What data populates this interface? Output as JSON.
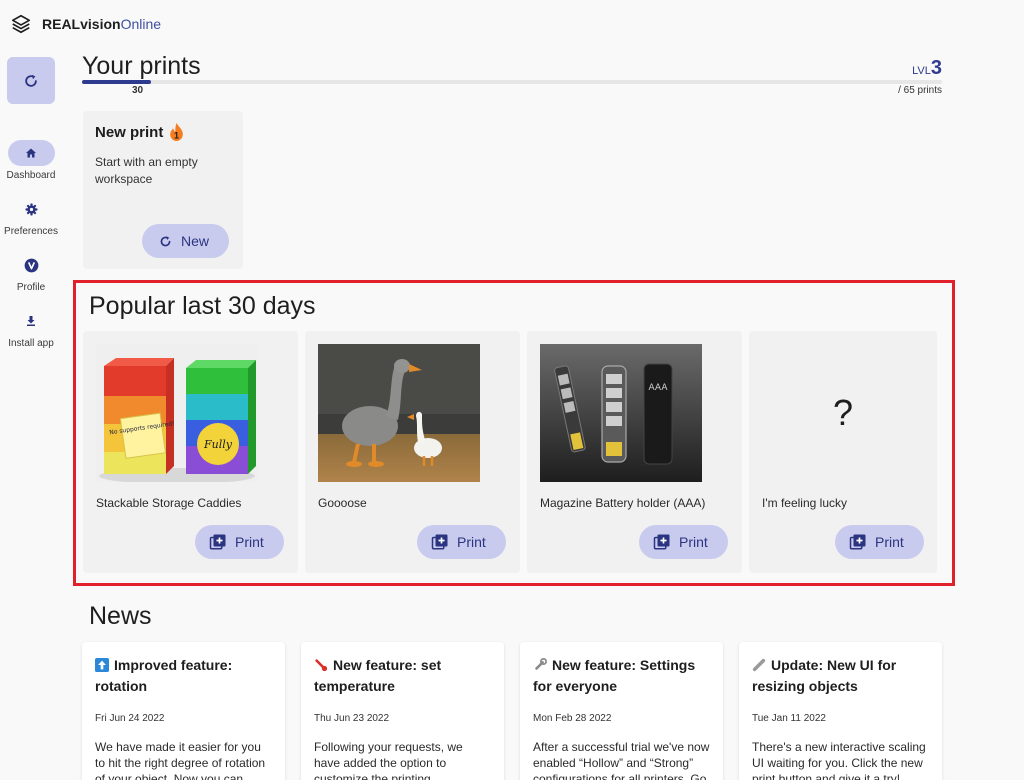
{
  "brand": {
    "bold": "REALvision",
    "accent": "Online",
    "logo_icon": "stacked-layers-icon"
  },
  "sidebar": {
    "refresh_icon": "refresh-icon",
    "items": [
      {
        "label": "Dashboard",
        "icon": "home-icon",
        "active": true
      },
      {
        "label": "Preferences",
        "icon": "gear-icon",
        "active": false
      },
      {
        "label": "Profile",
        "icon": "user-v-icon",
        "active": false
      },
      {
        "label": "Install app",
        "icon": "download-icon",
        "active": false
      }
    ]
  },
  "prints": {
    "title": "Your prints",
    "count": "30",
    "level_prefix": "LVL",
    "level": "3",
    "total": "/ 65 prints",
    "progress": 0.08
  },
  "new_print": {
    "title": "New print",
    "badge": "1",
    "description": "Start with an empty workspace",
    "button": "New"
  },
  "popular": {
    "title": "Popular last 30 days",
    "items": [
      {
        "name": "Stackable Storage Caddies",
        "button": "Print",
        "note_text": "No supports required!",
        "seal_text": "Fully"
      },
      {
        "name": "Goooose",
        "button": "Print"
      },
      {
        "name": "Magazine Battery holder (AAA)",
        "button": "Print",
        "label": "AAA"
      },
      {
        "name": "I'm feeling lucky",
        "button": "Print",
        "glyph": "?"
      }
    ]
  },
  "news": {
    "title": "News",
    "items": [
      {
        "icon": "arrow-up-icon",
        "title": "Improved feature: rotation",
        "date": "Fri Jun 24 2022",
        "body": "We have made it easier for you to hit the right degree of rotation of your object. Now you can prepare"
      },
      {
        "icon": "thermometer-icon",
        "title": "New feature: set temperature",
        "date": "Thu Jun 23 2022",
        "body": "Following your requests, we have added the option to customize the printing temperature. Start a"
      },
      {
        "icon": "wrench-icon",
        "title": "New feature: Settings for everyone",
        "date": "Mon Feb 28 2022",
        "body": "After a successful trial we've now enabled “Hollow” and “Strong” configurations for all printers. Go"
      },
      {
        "icon": "ruler-icon",
        "title": "Update: New UI for resizing objects",
        "date": "Tue Jan 11 2022",
        "body": "There's a new interactive scaling UI waiting for you. Click the new print button and give it a try!"
      }
    ]
  },
  "colors": {
    "accent": "#2f3b8e",
    "pill": "#c9cbee",
    "highlight": "#e0202a"
  }
}
